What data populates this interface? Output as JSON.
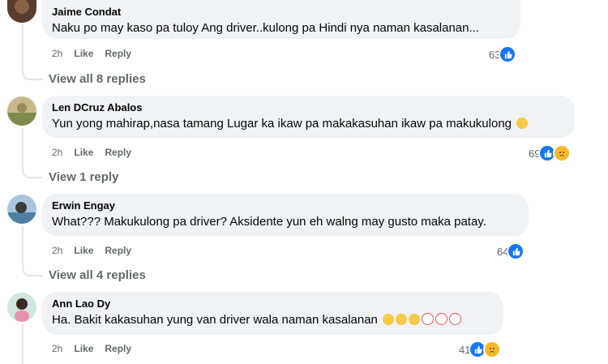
{
  "comments": [
    {
      "author": "Jaime Condat",
      "text": "Naku po may kaso pa tuloy Ang driver..kulong pa Hindi nya naman kasalanan...",
      "time": "2h",
      "like_label": "Like",
      "reply_label": "Reply",
      "reaction_count": "63",
      "reactions": [
        "like-icon"
      ],
      "view_replies": "View all 8 replies"
    },
    {
      "author": "Len DCruz Abalos",
      "text": "Yun yong mahirap,nasa tamang Lugar ka ikaw pa makakasuhan ikaw pa makukulong",
      "trailing_emojis": [
        "sad-face-emoji"
      ],
      "time": "2h",
      "like_label": "Like",
      "reply_label": "Reply",
      "reaction_count": "69",
      "reactions": [
        "like-icon",
        "sad-icon"
      ],
      "view_replies": "View 1 reply"
    },
    {
      "author": "Erwin Engay",
      "text": "What??? Makukulong pa driver? Aksidente yun eh walng may gusto maka patay.",
      "time": "2h",
      "like_label": "Like",
      "reply_label": "Reply",
      "reaction_count": "64",
      "reactions": [
        "like-icon"
      ],
      "view_replies": "View all 4 replies"
    },
    {
      "author": "Ann Lao Dy",
      "text": "Ha. Bakit kakasuhan yung van driver wala naman kasalanan",
      "trailing_emojis": [
        "crying-face-emoji",
        "crying-face-emoji",
        "crying-face-emoji",
        "clown-face-emoji",
        "clown-face-emoji",
        "clown-face-emoji"
      ],
      "time": "2h",
      "like_label": "Like",
      "reply_label": "Reply",
      "reaction_count": "41",
      "reactions": [
        "like-icon",
        "sad-icon"
      ]
    }
  ],
  "colors": {
    "bubble": "#f0f2f5",
    "meta_text": "#65676b",
    "like_blue": "#1877f2",
    "sad_yellow": "#f7b928"
  }
}
